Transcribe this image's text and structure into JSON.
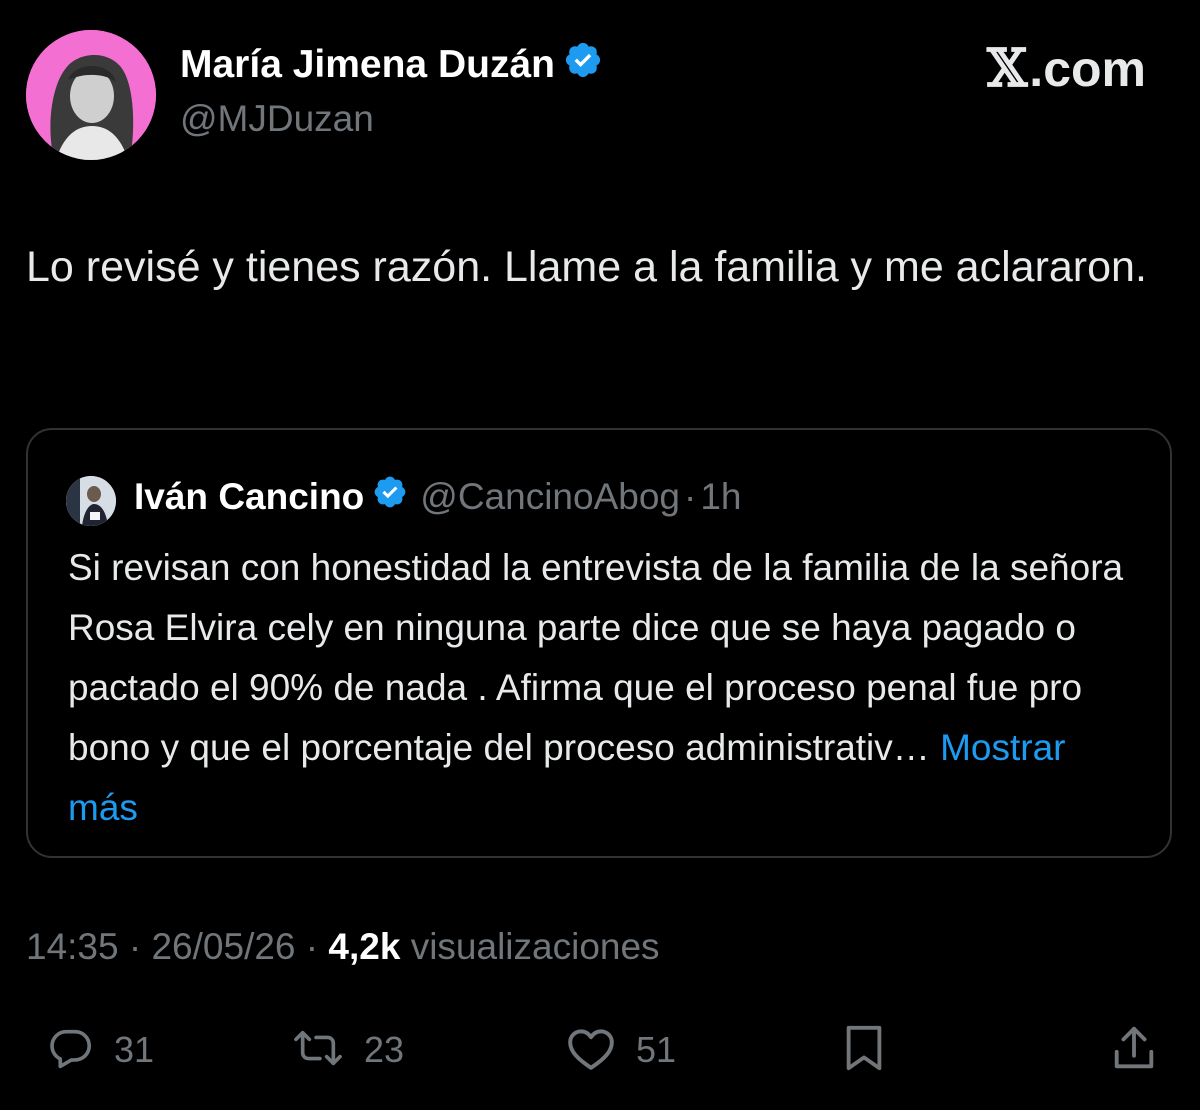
{
  "header": {
    "author_name": "María Jimena Duzán",
    "author_handle": "@MJDuzan",
    "brand_x": "𝕏",
    "brand_suffix": ".com"
  },
  "tweet": {
    "text": "Lo revisé y tienes razón. Llame a la familia y me aclararon."
  },
  "quote": {
    "author_name": "Iván Cancino",
    "author_handle": "@CancinoAbog",
    "separator": "·",
    "time": "1h",
    "text": "Si revisan con honestidad la entrevista de la familia de la señora Rosa Elvira cely en ninguna parte dice que se haya pagado o pactado el 90% de nada . Afirma que el proceso penal fue pro bono y que el porcentaje del proceso administrativ…",
    "show_more": "Mostrar más"
  },
  "meta": {
    "time": "14:35",
    "sep1": " · ",
    "date": "26/05/26",
    "sep2": " · ",
    "views_count": "4,2k",
    "views_label": " visualizaciones"
  },
  "actions": {
    "reply_count": "31",
    "repost_count": "23",
    "like_count": "51"
  },
  "colors": {
    "background": "#000000",
    "text": "#e7e9ea",
    "secondary": "#71767b",
    "accent": "#1d9bf0",
    "border": "#2f3336",
    "avatar_bg": "#f46fd2"
  },
  "icons": [
    "verified-badge-icon",
    "reply-icon",
    "repost-icon",
    "like-icon",
    "bookmark-icon",
    "share-icon"
  ]
}
